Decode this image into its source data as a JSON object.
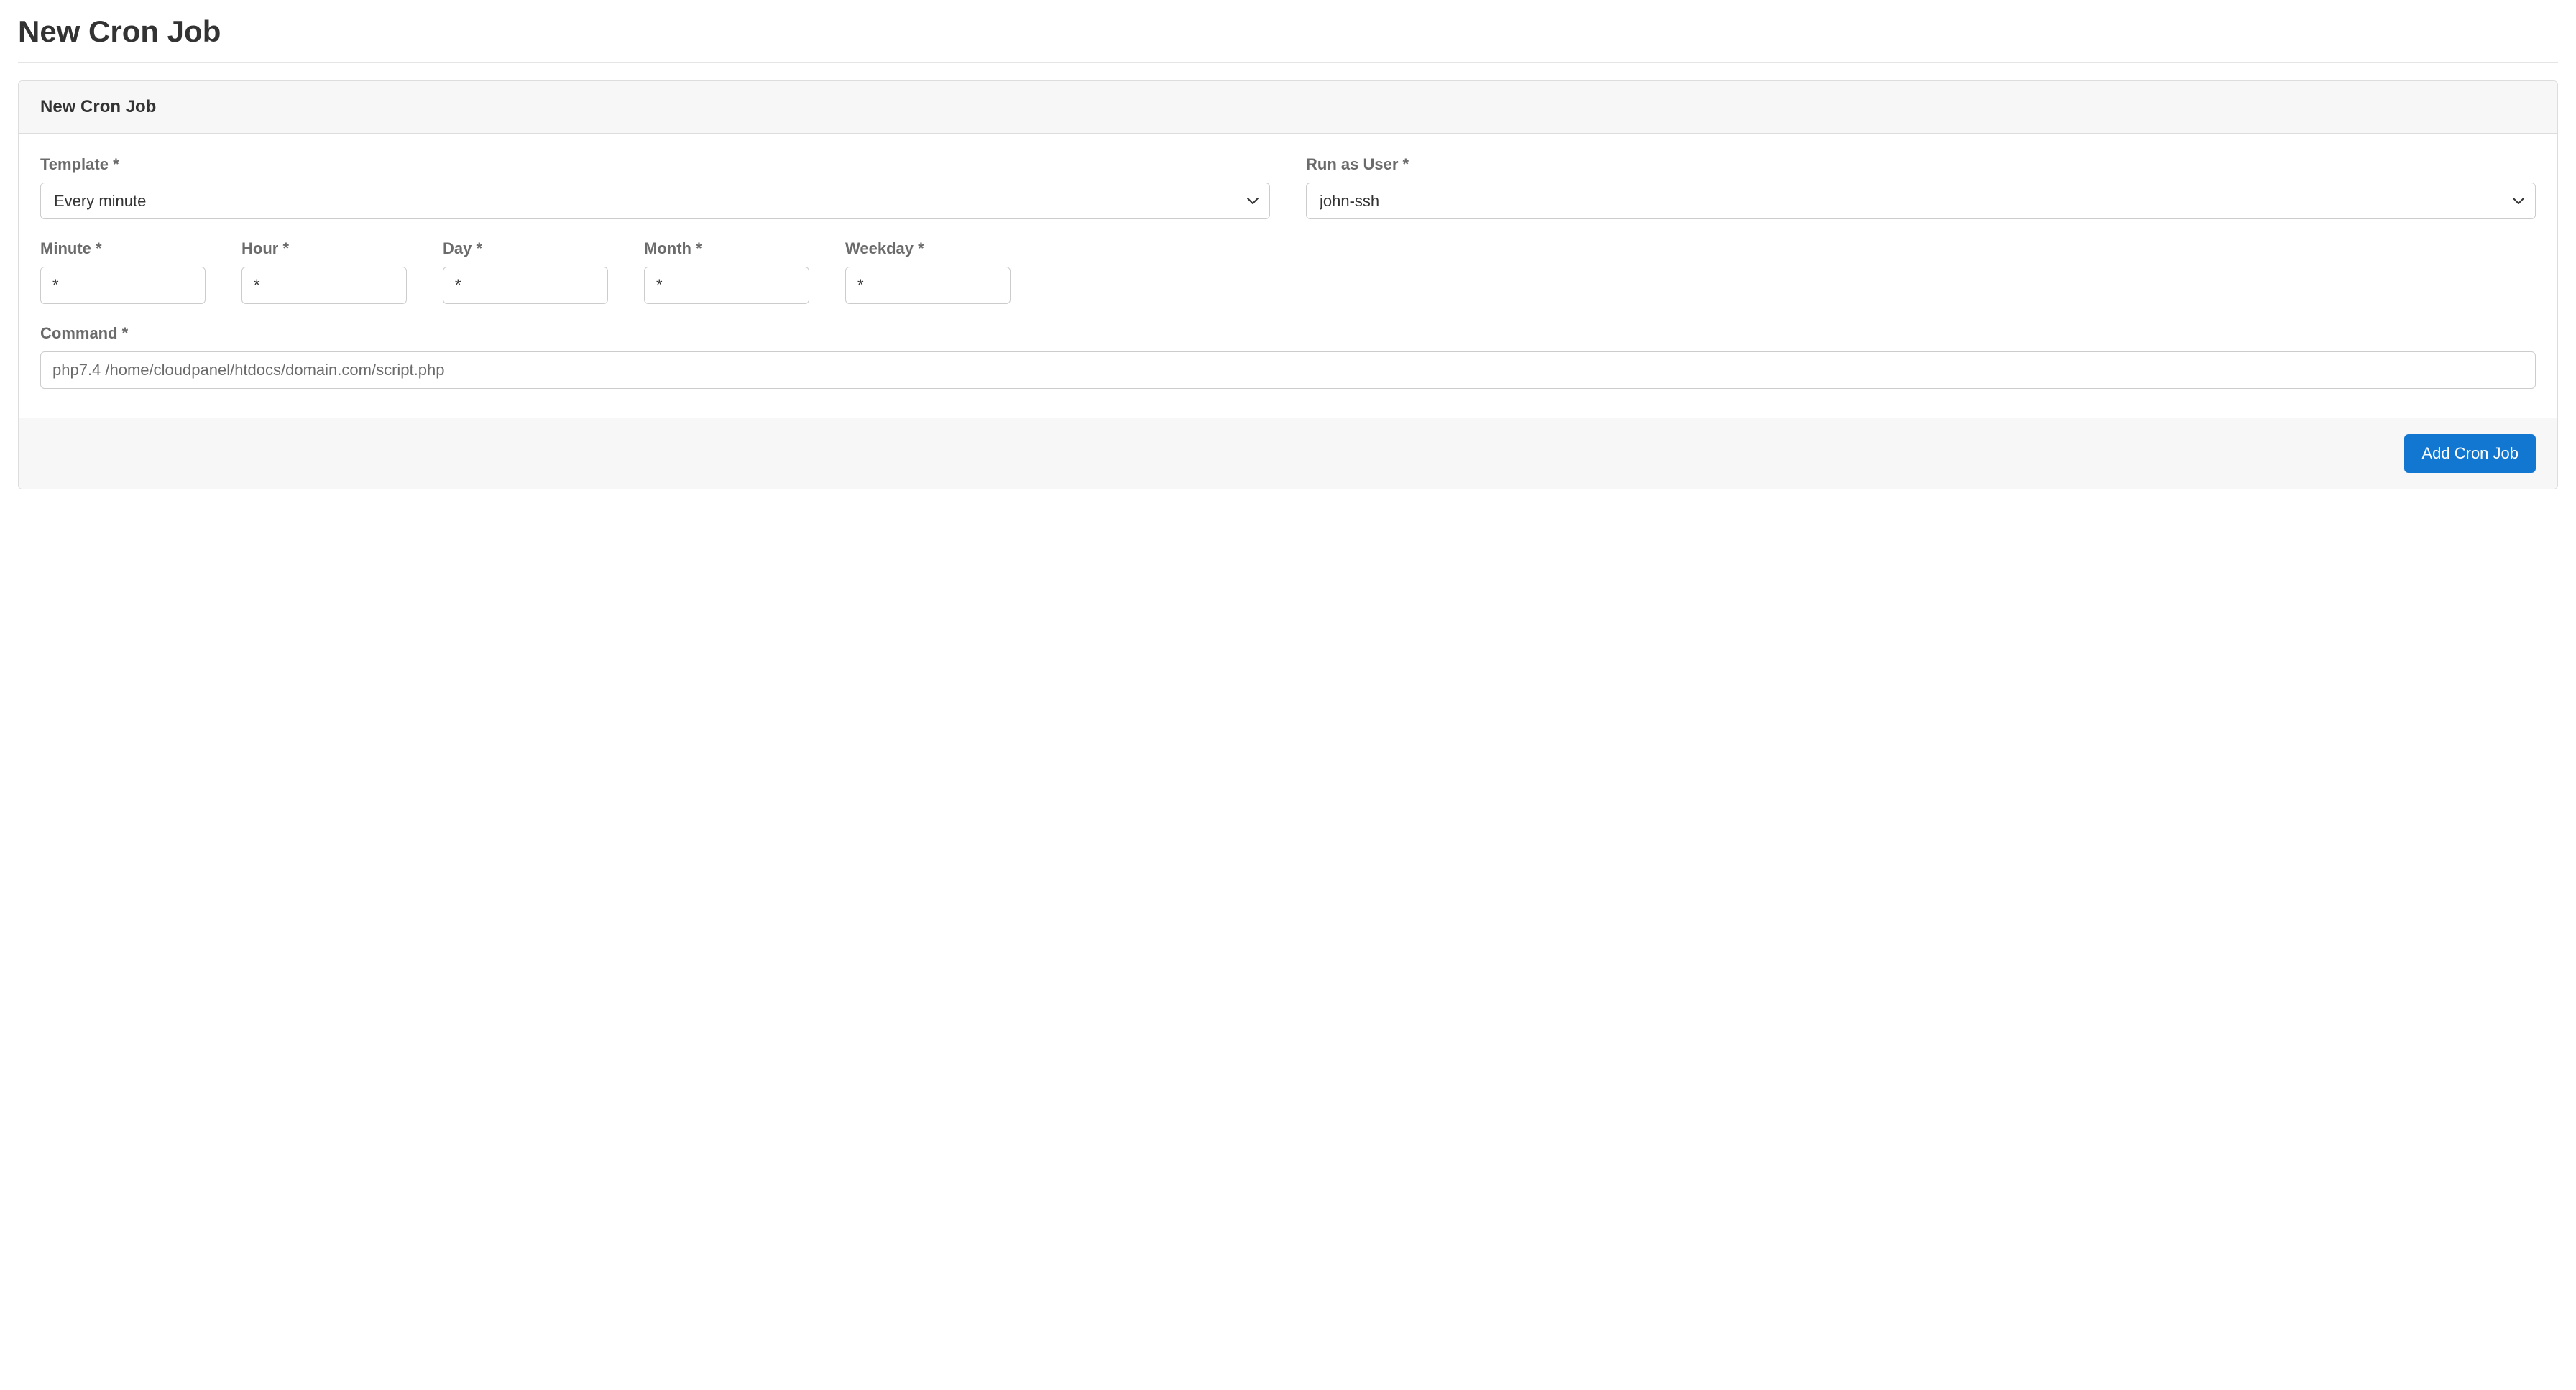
{
  "page": {
    "title": "New Cron Job"
  },
  "card": {
    "header": "New Cron Job"
  },
  "form": {
    "template": {
      "label": "Template *",
      "value": "Every minute"
    },
    "runAsUser": {
      "label": "Run as User *",
      "value": "john-ssh"
    },
    "minute": {
      "label": "Minute *",
      "value": "*"
    },
    "hour": {
      "label": "Hour *",
      "value": "*"
    },
    "day": {
      "label": "Day *",
      "value": "*"
    },
    "month": {
      "label": "Month *",
      "value": "*"
    },
    "weekday": {
      "label": "Weekday *",
      "value": "*"
    },
    "command": {
      "label": "Command *",
      "placeholder": "php7.4 /home/cloudpanel/htdocs/domain.com/script.php"
    }
  },
  "footer": {
    "submitLabel": "Add Cron Job"
  }
}
